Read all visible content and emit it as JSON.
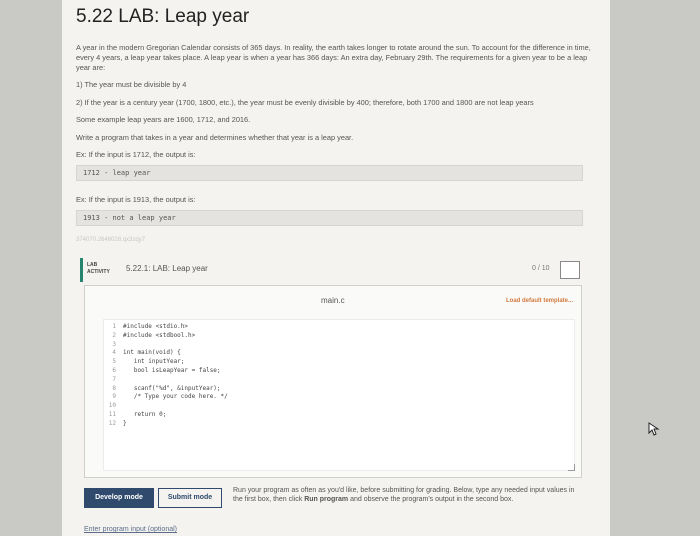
{
  "title": "5.22 LAB: Leap year",
  "intro": "A year in the modern Gregorian Calendar consists of 365 days. In reality, the earth takes longer to rotate around the sun. To account for the difference in time, every 4 years, a leap year takes place. A leap year is when a year has 366 days: An extra day, February 29th. The requirements for a given year to be a leap year are:",
  "rule1": "1) The year must be divisible by 4",
  "rule2": "2) If the year is a century year (1700, 1800, etc.), the year must be evenly divisible by 400; therefore, both 1700 and 1800 are not leap years",
  "examples": "Some example leap years are 1600, 1712, and 2016.",
  "task": "Write a program that takes in a year and determines whether that year is a leap year.",
  "ex1_label": "Ex: If the input is 1712, the output is:",
  "ex1_output": "1712 - leap year",
  "ex2_label": "Ex: If the input is 1913, the output is:",
  "ex2_output": "1913 - not a leap year",
  "faint_text": "374070.2646028.qx3zqy7",
  "lab": {
    "badge_line1": "LAB",
    "badge_line2": "ACTIVITY",
    "name": "5.22.1: LAB: Leap year",
    "score": "0 / 10"
  },
  "editor": {
    "file_name": "main.c",
    "load_template": "Load default template...",
    "line_numbers": "1\n2\n3\n4\n5\n6\n7\n8\n9\n10\n11\n12",
    "code": "#include <stdio.h>\n#include <stdbool.h>\n\nint main(void) {\n   int inputYear;\n   bool isLeapYear = false;\n\n   scanf(\"%d\", &inputYear);\n   /* Type your code here. */\n\n   return 0;\n}"
  },
  "buttons": {
    "develop": "Develop mode",
    "submit": "Submit mode"
  },
  "run_text_1": "Run your program as often as you'd like, before submitting for grading. Below, type any needed input values in the first box, then click ",
  "run_text_bold": "Run program",
  "run_text_2": " and observe the program's output in the second box.",
  "input_label": "Enter program input (optional)"
}
